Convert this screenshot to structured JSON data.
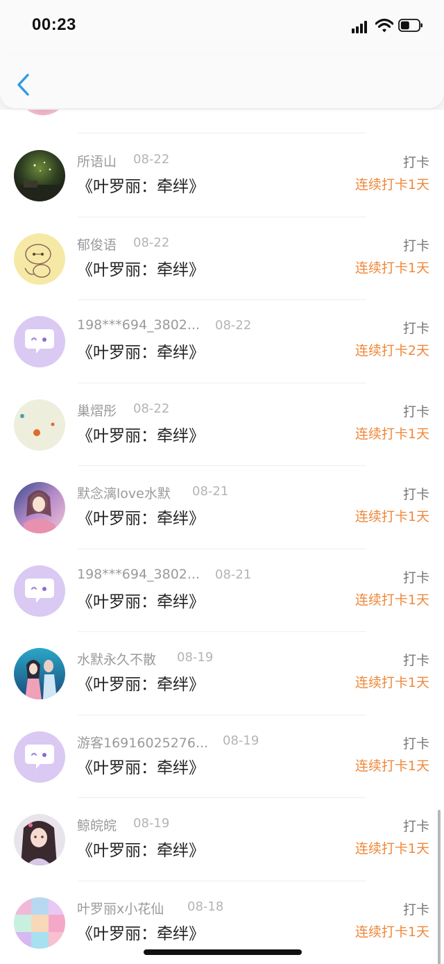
{
  "status_bar": {
    "time": "00:23"
  },
  "nav": {
    "back_icon": "chevron-left-icon"
  },
  "rows": [
    {
      "name": "所语山",
      "date": "08-22",
      "title": "《叶罗丽：牵绊》",
      "action": "打卡",
      "streak": "连续打卡1天",
      "avatar": "night-sky"
    },
    {
      "name": "郁俊语",
      "date": "08-22",
      "title": "《叶罗丽：牵绊》",
      "action": "打卡",
      "streak": "连续打卡1天",
      "avatar": "baymax-sketch"
    },
    {
      "name": "198***694_3802...",
      "date": "08-22",
      "title": "《叶罗丽：牵绊》",
      "action": "打卡",
      "streak": "连续打卡2天",
      "avatar": "chat-bubble"
    },
    {
      "name": "巢熠彤",
      "date": "08-22",
      "title": "《叶罗丽：牵绊》",
      "action": "打卡",
      "streak": "连续打卡1天",
      "avatar": "dots"
    },
    {
      "name": "默念漓love水默",
      "date": "08-21",
      "title": "《叶罗丽：牵绊》",
      "action": "打卡",
      "streak": "连续打卡1天",
      "avatar": "anime-girl-1"
    },
    {
      "name": "198***694_3802...",
      "date": "08-21",
      "title": "《叶罗丽：牵绊》",
      "action": "打卡",
      "streak": "连续打卡1天",
      "avatar": "chat-bubble"
    },
    {
      "name": "水默永久不散",
      "date": "08-19",
      "title": "《叶罗丽：牵绊》",
      "action": "打卡",
      "streak": "连续打卡1天",
      "avatar": "anime-couple"
    },
    {
      "name": "游客16916025276...",
      "date": "08-19",
      "title": "《叶罗丽：牵绊》",
      "action": "打卡",
      "streak": "连续打卡1天",
      "avatar": "chat-bubble"
    },
    {
      "name": "鲸皖皖",
      "date": "08-19",
      "title": "《叶罗丽：牵绊》",
      "action": "打卡",
      "streak": "连续打卡1天",
      "avatar": "anime-girl-2"
    },
    {
      "name": "叶罗丽x小花仙",
      "date": "08-18",
      "title": "《叶罗丽：牵绊》",
      "action": "打卡",
      "streak": "连续打卡1天",
      "avatar": "collage"
    }
  ],
  "colors": {
    "streak": "#f0873a",
    "back": "#2e9be6",
    "bubble": "#d9c9f3"
  }
}
